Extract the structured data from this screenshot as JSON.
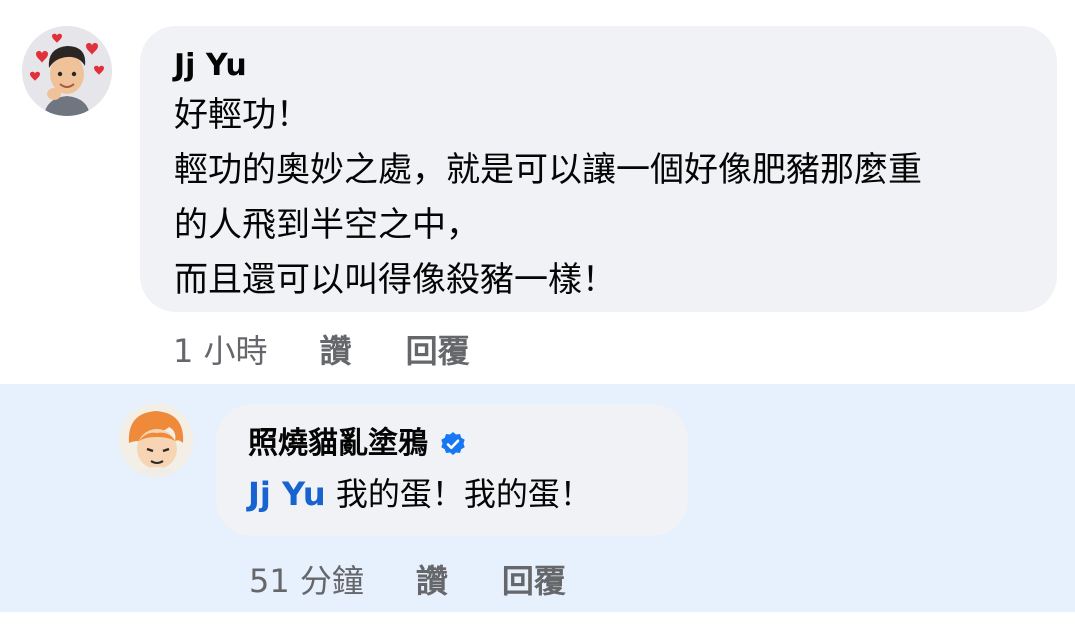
{
  "comment": {
    "author": "Jj Yu",
    "lines": [
      "好輕功！",
      "輕功的奧妙之處，就是可以讓一個好像肥豬那麼重",
      "的人飛到半空之中，",
      "而且還可以叫得像殺豬一樣！"
    ],
    "time": "1 小時",
    "like_label": "讚",
    "reply_label": "回覆"
  },
  "reply": {
    "author": "照燒貓亂塗鴉",
    "verified_icon": "verified-badge-icon",
    "mention": "Jj Yu",
    "text": " 我的蛋！我的蛋！",
    "time": "51 分鐘",
    "like_label": "讚",
    "reply_label": "回覆"
  },
  "colors": {
    "bubble": "#f0f2f5",
    "highlight": "#e7f0fd",
    "mention": "#1763cf",
    "meta": "#65676b",
    "verified": "#1877f2"
  }
}
